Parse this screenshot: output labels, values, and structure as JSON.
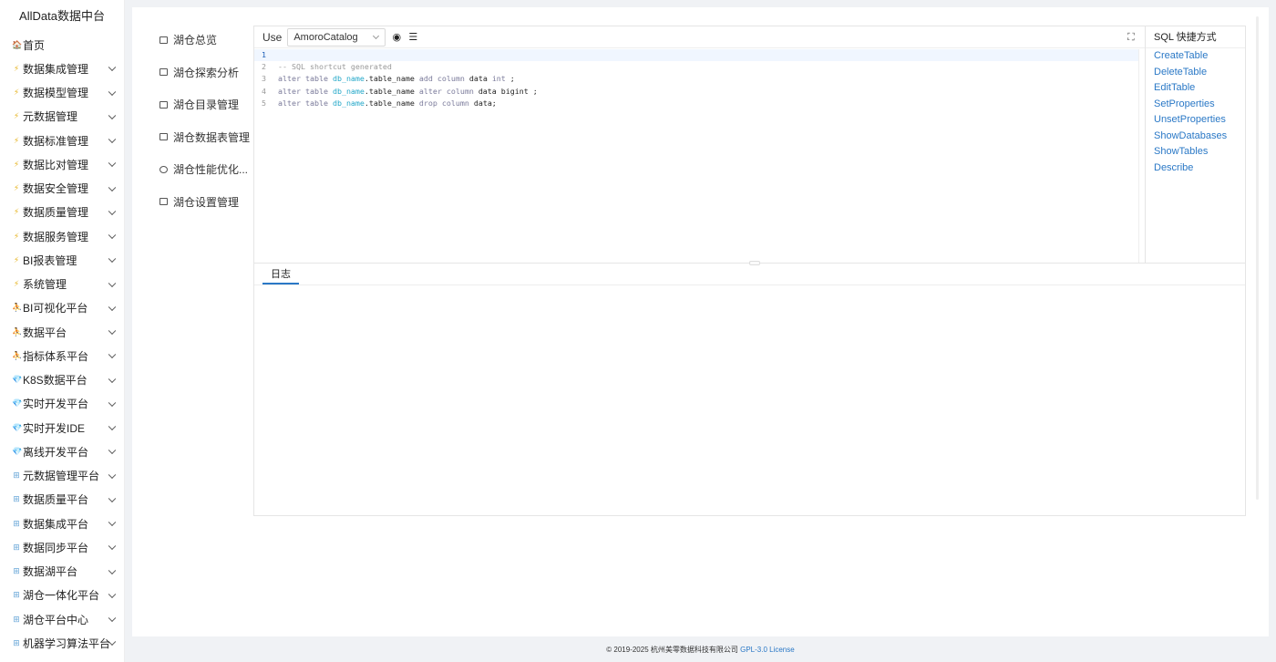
{
  "app": {
    "title": "AllData数据中台"
  },
  "sidebar": {
    "items": [
      {
        "label": "首页",
        "icon": "home-icon",
        "has_children": false
      },
      {
        "label": "数据集成管理",
        "icon": "bolt-icon",
        "has_children": true
      },
      {
        "label": "数据模型管理",
        "icon": "bolt-icon",
        "has_children": true
      },
      {
        "label": "元数据管理",
        "icon": "bolt-icon",
        "has_children": true
      },
      {
        "label": "数据标准管理",
        "icon": "bolt-icon",
        "has_children": true
      },
      {
        "label": "数据比对管理",
        "icon": "bolt-icon",
        "has_children": true
      },
      {
        "label": "数据安全管理",
        "icon": "bolt-icon",
        "has_children": true
      },
      {
        "label": "数据质量管理",
        "icon": "bolt-icon",
        "has_children": true
      },
      {
        "label": "数据服务管理",
        "icon": "bolt-icon",
        "has_children": true
      },
      {
        "label": "BI报表管理",
        "icon": "bolt-icon",
        "has_children": true
      },
      {
        "label": "系统管理",
        "icon": "bolt-icon",
        "has_children": true
      },
      {
        "label": "BI可视化平台",
        "icon": "person-icon",
        "has_children": true
      },
      {
        "label": "数据平台",
        "icon": "person-icon",
        "has_children": true
      },
      {
        "label": "指标体系平台",
        "icon": "person-icon",
        "has_children": true
      },
      {
        "label": "K8S数据平台",
        "icon": "gem-icon",
        "has_children": true
      },
      {
        "label": "实时开发平台",
        "icon": "gem-icon",
        "has_children": true
      },
      {
        "label": "实时开发IDE",
        "icon": "gem-icon",
        "has_children": true
      },
      {
        "label": "离线开发平台",
        "icon": "gem-icon",
        "has_children": true
      },
      {
        "label": "元数据管理平台",
        "icon": "grid-icon",
        "has_children": true
      },
      {
        "label": "数据质量平台",
        "icon": "grid-icon",
        "has_children": true
      },
      {
        "label": "数据集成平台",
        "icon": "grid-icon",
        "has_children": true
      },
      {
        "label": "数据同步平台",
        "icon": "grid-icon",
        "has_children": true
      },
      {
        "label": "数据湖平台",
        "icon": "grid-icon",
        "has_children": true
      },
      {
        "label": "湖仓一体化平台",
        "icon": "grid-icon",
        "has_children": true
      },
      {
        "label": "湖仓平台中心",
        "icon": "grid-icon",
        "has_children": true
      },
      {
        "label": "机器学习算法平台",
        "icon": "grid-icon",
        "has_children": true
      }
    ]
  },
  "subnav": {
    "items": [
      {
        "label": "湖仓总览",
        "icon": "image-icon"
      },
      {
        "label": "湖仓探索分析",
        "icon": "terminal-icon"
      },
      {
        "label": "湖仓目录管理",
        "icon": "document-icon"
      },
      {
        "label": "湖仓数据表管理",
        "icon": "table-icon"
      },
      {
        "label": "湖仓性能优化...",
        "icon": "gauge-icon"
      },
      {
        "label": "湖仓设置管理",
        "icon": "monitor-icon"
      }
    ]
  },
  "editor": {
    "use_label": "Use",
    "catalog_selected": "AmoroCatalog",
    "lines": [
      {
        "n": "1",
        "parts": []
      },
      {
        "n": "2",
        "parts": [
          {
            "t": "-- SQL shortcut generated",
            "c": "k-cm"
          }
        ]
      },
      {
        "n": "3",
        "parts": [
          {
            "t": "alter table ",
            "c": "k-kw"
          },
          {
            "t": "db_name",
            "c": "k-db"
          },
          {
            "t": ".table_name ",
            "c": ""
          },
          {
            "t": "add column ",
            "c": "k-kw"
          },
          {
            "t": "data ",
            "c": ""
          },
          {
            "t": "int",
            "c": "k-ty"
          },
          {
            "t": " ;",
            "c": ""
          }
        ]
      },
      {
        "n": "4",
        "parts": [
          {
            "t": "alter table ",
            "c": "k-kw"
          },
          {
            "t": "db_name",
            "c": "k-db"
          },
          {
            "t": ".table_name ",
            "c": ""
          },
          {
            "t": "alter column ",
            "c": "k-kw"
          },
          {
            "t": "data bigint ;",
            "c": ""
          }
        ]
      },
      {
        "n": "5",
        "parts": [
          {
            "t": "alter table ",
            "c": "k-kw"
          },
          {
            "t": "db_name",
            "c": "k-db"
          },
          {
            "t": ".table_name ",
            "c": ""
          },
          {
            "t": "drop column ",
            "c": "k-kw"
          },
          {
            "t": "data;",
            "c": ""
          }
        ]
      }
    ]
  },
  "shortcuts": {
    "title": "SQL 快捷方式",
    "items": [
      "CreateTable",
      "DeleteTable",
      "EditTable",
      "SetProperties",
      "UnsetProperties",
      "ShowDatabases",
      "ShowTables",
      "Describe"
    ]
  },
  "log": {
    "tab_label": "日志"
  },
  "footer": {
    "copyright": "© 2019-2025 杭州美零数据科技有限公司 ",
    "license": "GPL-3.0 License"
  },
  "colors": {
    "accent": "#2a78c6",
    "link": "#2a78c6"
  }
}
